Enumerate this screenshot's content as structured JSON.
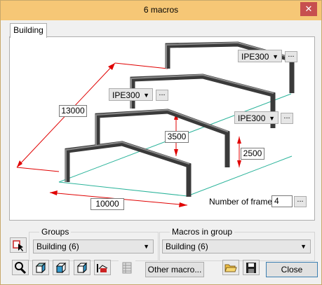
{
  "window": {
    "title": "6 macros",
    "close_glyph": "✕"
  },
  "tabs": [
    {
      "label": "Building"
    }
  ],
  "drawing": {
    "frame_profiles": [
      "IPE300",
      "IPE300",
      "IPE300"
    ],
    "dim_length": "13000",
    "dim_width": "10000",
    "dim_ridge": "3500",
    "dim_height": "2500",
    "frames_label": "Number of frames:",
    "frames_value": "4",
    "dots": "..."
  },
  "groups": {
    "legend": "Groups",
    "selected": "Building (6)"
  },
  "macros": {
    "legend": "Macros in group",
    "selected": "Building (6)"
  },
  "toolbar": {
    "other_macro": "Other macro...",
    "close": "Close"
  },
  "colors": {
    "titlebar": "#f6c776",
    "dimension": "#e00000",
    "ground": "#2ab39a",
    "beam": "#5e5e5e"
  }
}
